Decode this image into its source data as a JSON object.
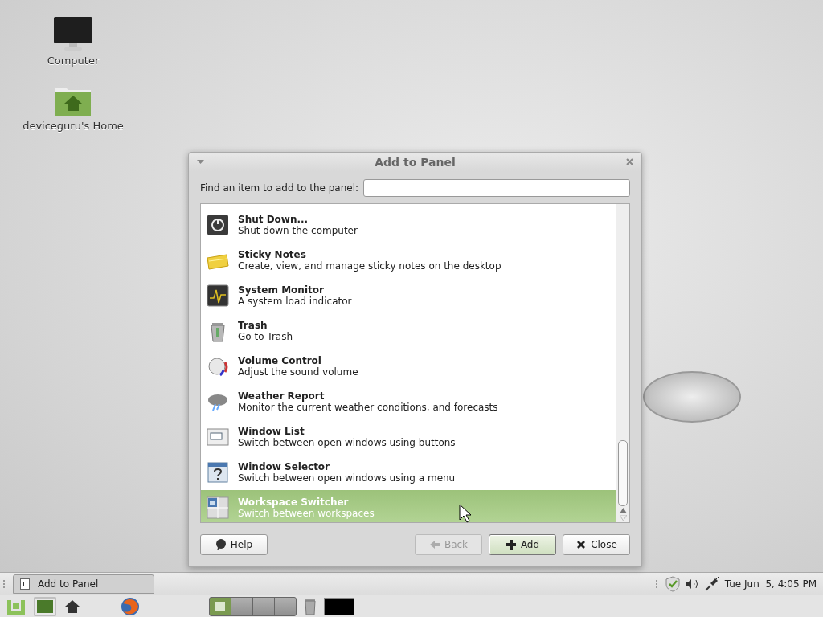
{
  "desktop_icons": [
    {
      "label": "Computer"
    },
    {
      "label": "deviceguru's Home"
    }
  ],
  "dialog": {
    "title": "Add to Panel",
    "search": {
      "label": "Find an item to add to the panel:"
    },
    "items": [
      {
        "name": "Shut Down...",
        "description": "Shut down the computer",
        "selected": false
      },
      {
        "name": "Sticky Notes",
        "description": "Create, view, and manage sticky notes on the desktop",
        "selected": false
      },
      {
        "name": "System Monitor",
        "description": "A system load indicator",
        "selected": false
      },
      {
        "name": "Trash",
        "description": "Go to Trash",
        "selected": false
      },
      {
        "name": "Volume Control",
        "description": "Adjust the sound volume",
        "selected": false
      },
      {
        "name": "Weather Report",
        "description": "Monitor the current weather conditions, and forecasts",
        "selected": false
      },
      {
        "name": "Window List",
        "description": "Switch between open windows using buttons",
        "selected": false
      },
      {
        "name": "Window Selector",
        "description": "Switch between open windows using a menu",
        "selected": false
      },
      {
        "name": "Workspace Switcher",
        "description": "Switch between workspaces",
        "selected": true
      }
    ],
    "buttons": [
      {
        "label": "Help",
        "disabled": false,
        "default": false
      },
      {
        "label": "Back",
        "disabled": true,
        "default": false
      },
      {
        "label": "Add",
        "disabled": false,
        "default": true
      },
      {
        "label": "Close",
        "disabled": false,
        "default": false
      }
    ]
  },
  "top_panel": {
    "window_buttons": [
      {
        "label": "Add to Panel"
      }
    ],
    "clock": "Tue Jun  5, 4:05 PM"
  },
  "bottom_panel": {
    "workspaces": [
      {
        "selected": true
      },
      {
        "selected": false
      },
      {
        "selected": false
      },
      {
        "selected": false
      }
    ]
  }
}
